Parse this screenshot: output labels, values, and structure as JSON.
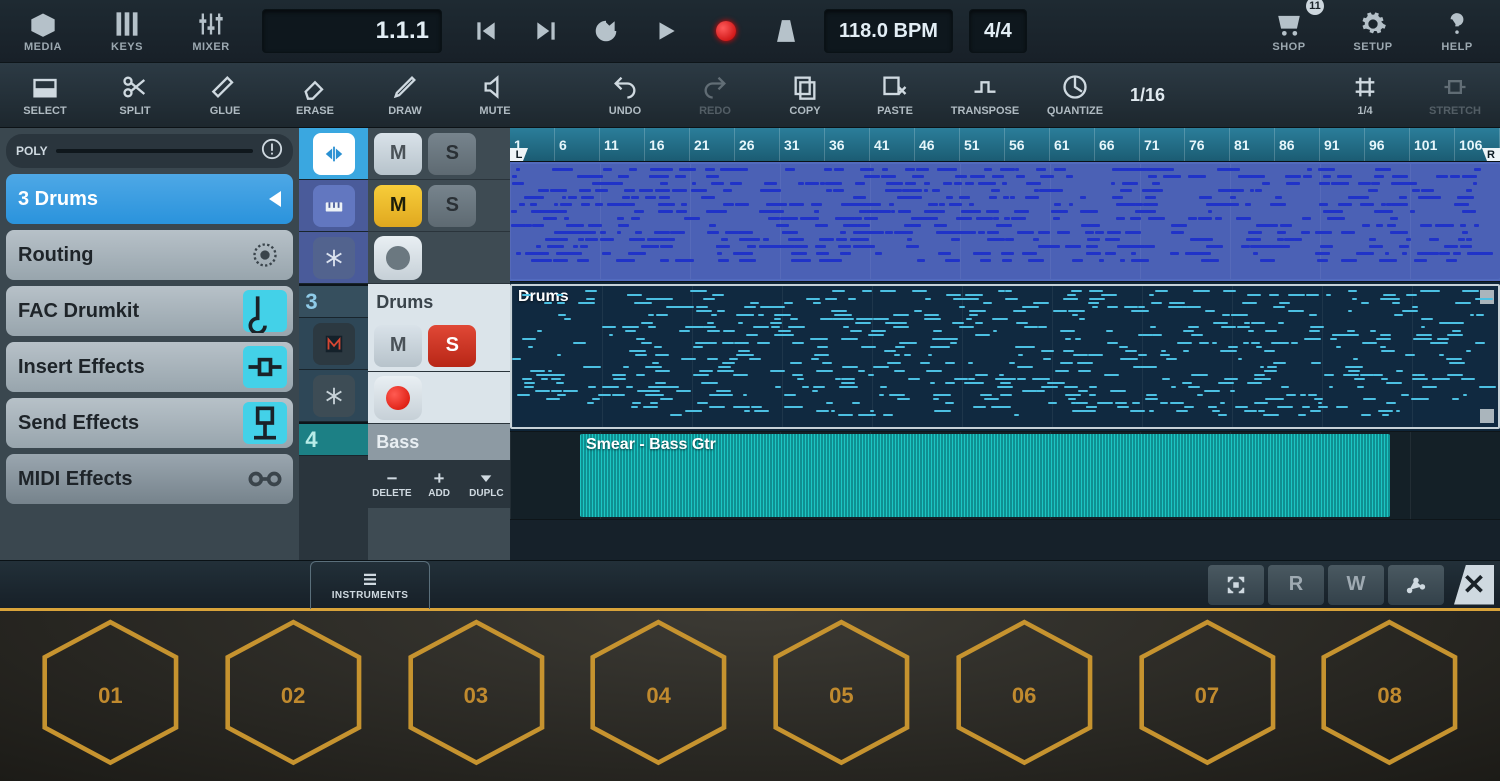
{
  "header1": {
    "media": "MEDIA",
    "keys": "KEYS",
    "mixer": "MIXER",
    "time": "1.1.1",
    "bpm": "118.0 BPM",
    "timesig": "4/4",
    "shop": "SHOP",
    "shop_badge": "11",
    "setup": "SETUP",
    "help": "HELP"
  },
  "tools": {
    "select": "SELECT",
    "split": "SPLIT",
    "glue": "GLUE",
    "erase": "ERASE",
    "draw": "DRAW",
    "mute": "MUTE",
    "undo": "UNDO",
    "redo": "REDO",
    "copy": "COPY",
    "paste": "PASTE",
    "transpose": "TRANSPOSE",
    "quantize": "QUANTIZE",
    "grid1": "1/16",
    "grid2": "1/4",
    "stretch": "STRETCH"
  },
  "inspector": {
    "poly": "POLY",
    "track_header": "3  Drums",
    "routing": "Routing",
    "instrument": "FAC Drumkit",
    "insert": "Insert Effects",
    "send": "Send Effects",
    "midi": "MIDI Effects"
  },
  "tracks": {
    "t3_num": "3",
    "t3_name": "Drums",
    "t4_num": "4",
    "t4_name": "Bass",
    "delete": "DELETE",
    "add": "ADD",
    "duplc": "DUPLC"
  },
  "clips": {
    "drums": "Drums",
    "bass": "Smear - Bass Gtr"
  },
  "locators": {
    "L": "L",
    "R": "R"
  },
  "ruler_ticks": [
    "1",
    "6",
    "11",
    "16",
    "21",
    "26",
    "31",
    "36",
    "41",
    "46",
    "51",
    "56",
    "61",
    "66",
    "71",
    "76",
    "81",
    "86",
    "91",
    "96",
    "101",
    "106"
  ],
  "strip": {
    "instruments": "INSTRUMENTS"
  },
  "pads": [
    "01",
    "02",
    "03",
    "04",
    "05",
    "06",
    "07",
    "08"
  ]
}
